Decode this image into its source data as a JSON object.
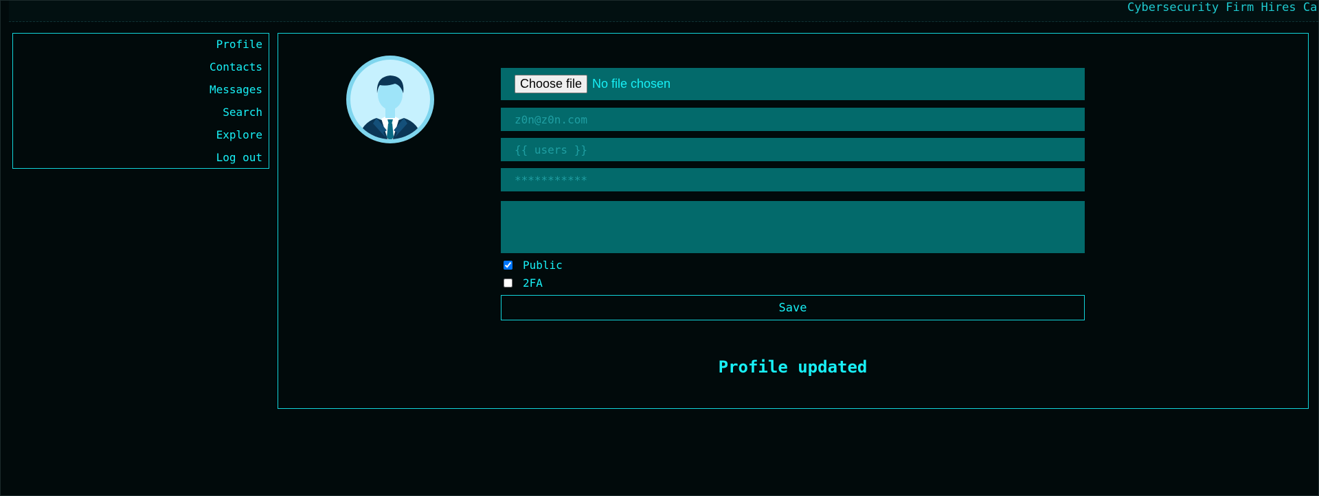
{
  "header": {
    "ticker_text": "Cybersecurity Firm Hires Ca"
  },
  "sidebar": {
    "items": [
      {
        "label": "Profile"
      },
      {
        "label": "Contacts"
      },
      {
        "label": "Messages"
      },
      {
        "label": "Search"
      },
      {
        "label": "Explore"
      },
      {
        "label": "Log out"
      }
    ]
  },
  "profile_form": {
    "avatar_icon": "user-avatar-icon",
    "file_button_label": "Choose file",
    "file_status": "No file chosen",
    "email_placeholder": "z0n@z0n.com",
    "users_placeholder": "{{ users }}",
    "password_placeholder": "***********",
    "bio_value": "",
    "public_label": "Public",
    "public_checked": true,
    "twofa_label": "2FA",
    "twofa_checked": false,
    "save_label": "Save",
    "status_message": "Profile updated"
  },
  "colors": {
    "accent": "#18f0f6",
    "field_background": "#036a6b",
    "page_background": "#010a0b"
  }
}
